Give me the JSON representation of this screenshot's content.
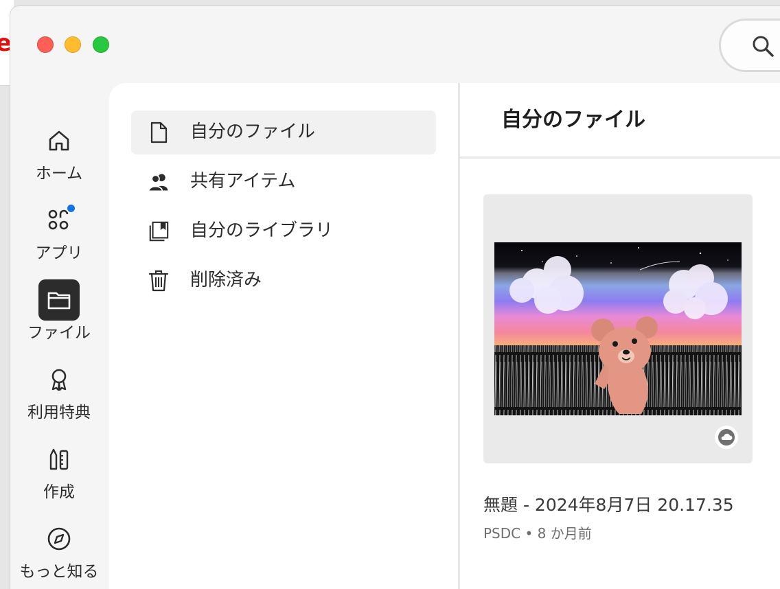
{
  "window": {
    "background_app_glyph": "e"
  },
  "search": {
    "icon": "search-icon"
  },
  "rail": {
    "items": [
      {
        "label": "ホーム",
        "icon": "home-icon",
        "active": false
      },
      {
        "label": "アプリ",
        "icon": "apps-icon",
        "active": false,
        "has_badge": true
      },
      {
        "label": "ファイル",
        "icon": "folder-icon",
        "active": true
      },
      {
        "label": "利用特典",
        "icon": "award-icon",
        "active": false
      },
      {
        "label": "作成",
        "icon": "create-tools-icon",
        "active": false
      },
      {
        "label": "もっと知る",
        "icon": "compass-icon",
        "active": false
      }
    ]
  },
  "nav": {
    "items": [
      {
        "label": "自分のファイル",
        "icon": "document-icon",
        "active": true
      },
      {
        "label": "共有アイテム",
        "icon": "people-icon",
        "active": false
      },
      {
        "label": "自分のライブラリ",
        "icon": "library-icon",
        "active": false
      },
      {
        "label": "削除済み",
        "icon": "trash-icon",
        "active": false
      }
    ]
  },
  "main": {
    "title": "自分のファイル",
    "files": [
      {
        "name": "無題 - 2024年8月7日 20.17.35",
        "meta": "PSDC • 8 か月前",
        "status_icon": "cloud-icon"
      }
    ]
  },
  "colors": {
    "accent_badge": "#1473e6",
    "active_rail": "#2c2c2c",
    "close": "#fe5f57",
    "minimize": "#febc2e",
    "maximize": "#28c840"
  }
}
